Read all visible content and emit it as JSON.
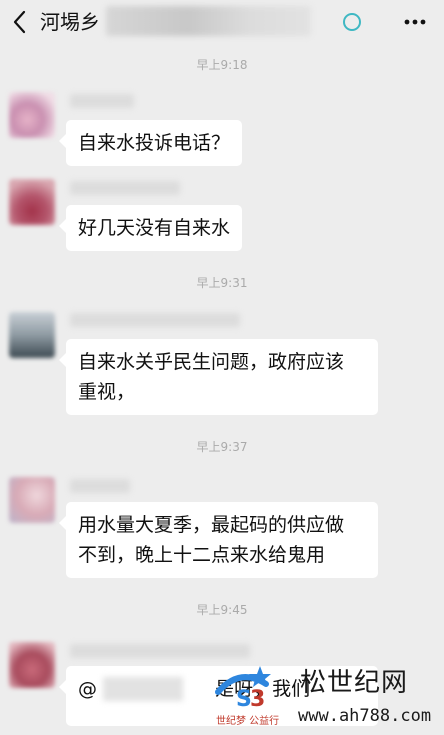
{
  "header": {
    "title": "河埸乡",
    "back_icon": "chevron-left-icon",
    "status_icon": "ring-icon",
    "more_icon": "more-dots-icon",
    "status_color": "#3fb8c3"
  },
  "messages": [
    {
      "time": "早上9:18",
      "text_lines": [
        "自来水投诉电话？"
      ]
    },
    {
      "time": "",
      "text_lines": [
        "好几天没有自来水"
      ]
    },
    {
      "time": "早上9:31",
      "text_lines": [
        "自来水关乎民生问题，政府应该",
        "重视，"
      ]
    },
    {
      "time": "早上9:37",
      "text_lines": [
        "用水量大夏季，最起码的供应做",
        "不到，晚上十二点来水给鬼用"
      ]
    },
    {
      "time": "早上9:45",
      "text_lines": [
        "@",
        "是呀，我们"
      ]
    }
  ],
  "watermark": {
    "cn_text": "世纪网",
    "partial_text": "松",
    "url": "www.ah788.com",
    "small_text": "世纪梦 公益行",
    "accent_color": "#2e86de"
  }
}
